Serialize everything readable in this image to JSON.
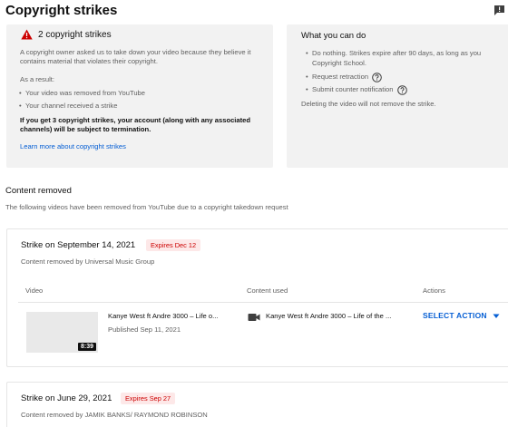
{
  "header": {
    "title": "Copyright strikes"
  },
  "left_card": {
    "strike_count": "2 copyright strikes",
    "owner_text": "A copyright owner asked us to take down your video because they believe it contains material that violates their copyright.",
    "as_result": "As a result:",
    "bullets": [
      "Your video was removed from YouTube",
      "Your channel received a strike"
    ],
    "warning_bold": "If you get 3 copyright strikes, your account (along with any associated channels) will be subject to termination.",
    "learn_more": "Learn more about copyright strikes"
  },
  "right_card": {
    "title": "What you can do",
    "options": [
      "Do nothing. Strikes expire after 90 days, as long as you",
      "Request retraction",
      "Submit counter notification"
    ],
    "option_1_cont": "Copyright School.",
    "deleting_note": "Deleting the video will not remove the strike."
  },
  "content_removed": {
    "title": "Content removed",
    "subtitle": "The following videos have been removed from YouTube due to a copyright takedown request"
  },
  "strikes": [
    {
      "title": "Strike on September 14, 2021",
      "expires": "Expires Dec 12",
      "removed_by": "Content removed by Universal Music Group",
      "columns": [
        "Video",
        "Content used",
        "Actions"
      ],
      "video": {
        "title": "Kanye West ft Andre 3000 – Life o...",
        "published": "Published Sep 11, 2021",
        "duration": "8:39"
      },
      "content_used": "Kanye West ft Andre 3000 – Life of the ...",
      "action_label": "SELECT ACTION"
    },
    {
      "title": "Strike on June 29, 2021",
      "expires": "Expires Sep 27",
      "removed_by": "Content removed by JAMIK BANKS/ RAYMOND ROBINSON"
    }
  ],
  "colors": {
    "accent_blue": "#065fd4",
    "warning_red": "#cc0000",
    "badge_bg": "#fde8e8",
    "card_bg": "#f2f2f2"
  },
  "icons": [
    "feedback-icon",
    "warning-icon",
    "help-icon",
    "video-camera-icon",
    "caret-down-icon"
  ]
}
